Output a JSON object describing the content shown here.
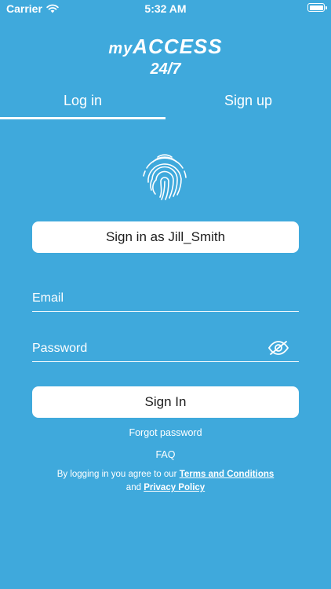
{
  "status_bar": {
    "carrier": "Carrier",
    "time": "5:32 AM"
  },
  "logo": {
    "line1_prefix": "my",
    "line1_main": "ACCESS",
    "line2": "24/7"
  },
  "tabs": [
    {
      "label": "Log in",
      "active": true
    },
    {
      "label": "Sign up",
      "active": false
    }
  ],
  "quick_signin": {
    "label": "Sign in as Jill_Smith"
  },
  "form": {
    "email_placeholder": "Email",
    "password_placeholder": "Password",
    "submit_label": "Sign In"
  },
  "links": {
    "forgot": "Forgot password",
    "faq": "FAQ",
    "legal_prefix": "By logging in you agree to our",
    "terms": "Terms and Conditions",
    "legal_and": "and",
    "privacy": "Privacy Policy"
  },
  "colors": {
    "background": "#3fa9dc",
    "button_bg": "#ffffff",
    "button_text": "#1d1d1d"
  },
  "icons": [
    "wifi-icon",
    "battery-icon",
    "fingerprint-icon",
    "eye-slash-icon"
  ]
}
